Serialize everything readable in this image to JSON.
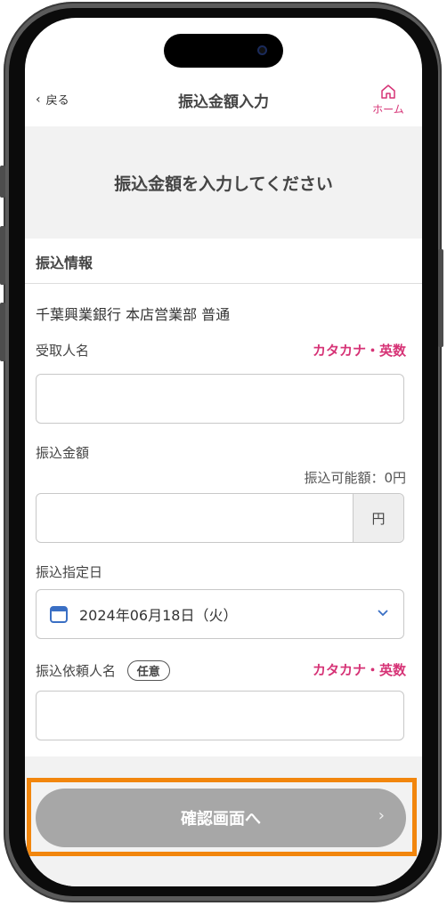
{
  "header": {
    "back_label": "戻る",
    "title": "振込金額入力",
    "home_label": "ホーム"
  },
  "banner": {
    "text": "振込金額を入力してください"
  },
  "section": {
    "title": "振込情報"
  },
  "bank": {
    "line": "千葉興業銀行 本店営業部 普通"
  },
  "recipient": {
    "label": "受取人名",
    "hint": "カタカナ・英数",
    "value": ""
  },
  "amount": {
    "label": "振込金額",
    "available": "振込可能額：0円",
    "unit": "円",
    "value": ""
  },
  "date": {
    "label": "振込指定日",
    "value": "2024年06月18日（火）"
  },
  "requester": {
    "label": "振込依頼人名",
    "optional_badge": "任意",
    "hint": "カタカナ・英数",
    "value": ""
  },
  "confirm_button": {
    "label": "確認画面へ",
    "arrow": "›"
  },
  "colors": {
    "accent": "#d63376",
    "highlight": "#f2860d",
    "button_disabled": "#a7a7a7",
    "calendar_icon": "#3a6fc4"
  }
}
